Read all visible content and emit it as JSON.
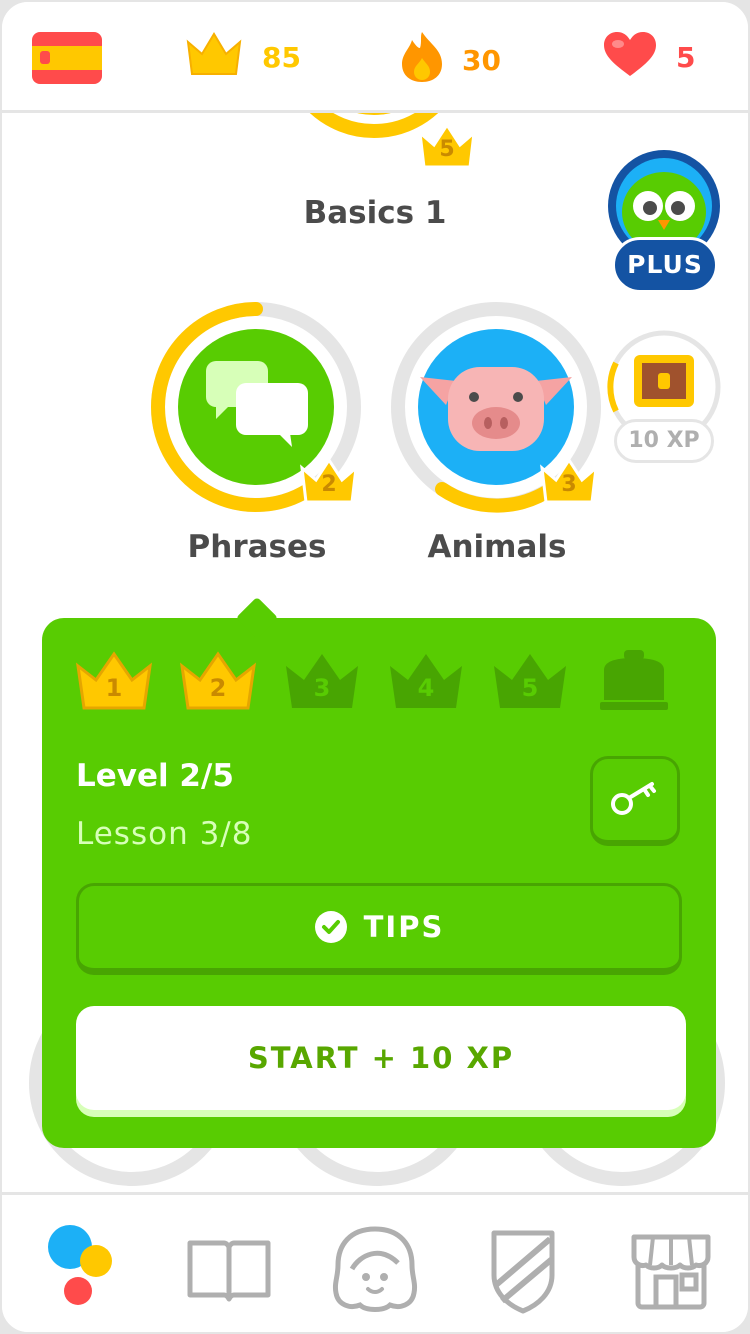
{
  "stats": {
    "crowns": "85",
    "streak": "30",
    "hearts": "5"
  },
  "skills": {
    "basics": {
      "name": "Basics 1",
      "crowns": "5"
    },
    "phrases": {
      "name": "Phrases",
      "crowns": "2"
    },
    "animals": {
      "name": "Animals",
      "crowns": "3"
    }
  },
  "plus_badge": "PLUS",
  "chest": {
    "reward": "10 XP"
  },
  "popup": {
    "levels": [
      "1",
      "2",
      "3",
      "4",
      "5"
    ],
    "level_title": "Level 2/5",
    "lesson_text": "Lesson 3/8",
    "tips_label": "TIPS",
    "start_label": "START + 10 XP"
  },
  "nav": [
    "learn-icon",
    "stories-icon",
    "profile-icon",
    "leaderboard-icon",
    "shop-icon"
  ],
  "colors": {
    "green": "#58cc02",
    "gold": "#ffc800",
    "orange": "#ff9600",
    "red": "#ff4b4b",
    "blue": "#1cb0f6"
  }
}
